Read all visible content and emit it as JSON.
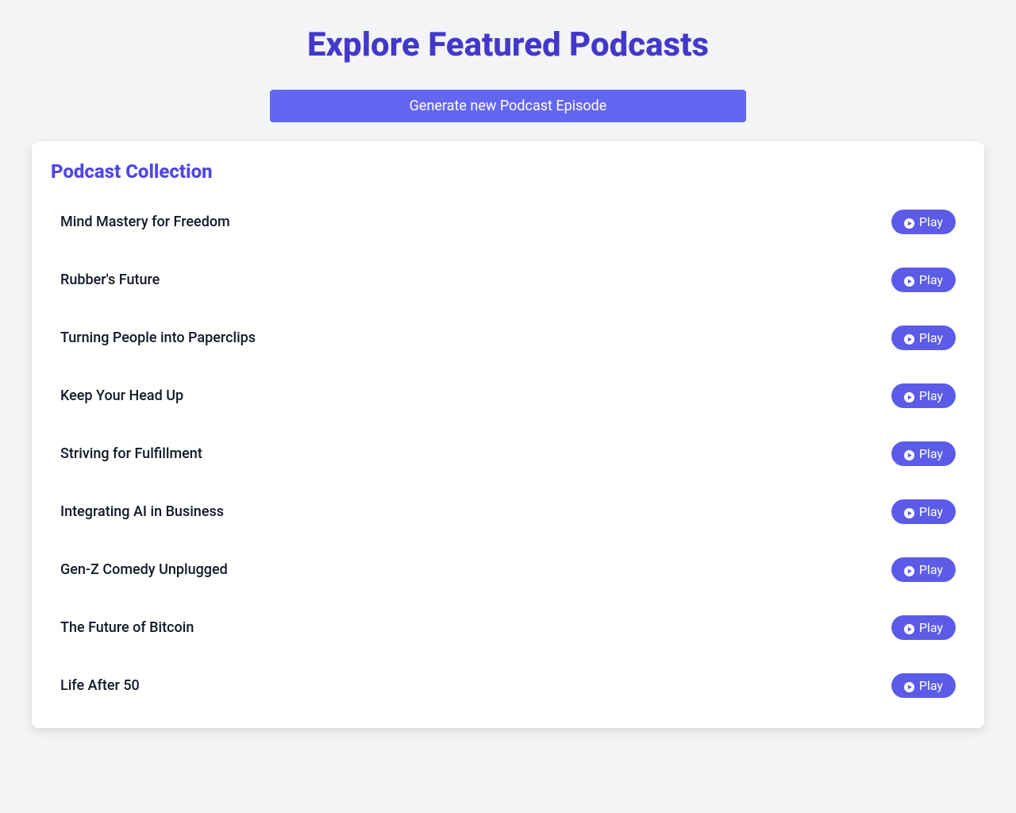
{
  "header": {
    "title": "Explore Featured Podcasts",
    "generate_button_label": "Generate new Podcast Episode"
  },
  "collection": {
    "heading": "Podcast Collection",
    "play_label": "Play",
    "items": [
      {
        "title": "Mind Mastery for Freedom"
      },
      {
        "title": "Rubber's Future"
      },
      {
        "title": "Turning People into Paperclips"
      },
      {
        "title": "Keep Your Head Up"
      },
      {
        "title": "Striving for Fulfillment"
      },
      {
        "title": "Integrating AI in Business"
      },
      {
        "title": "Gen-Z Comedy Unplugged"
      },
      {
        "title": "The Future of Bitcoin"
      },
      {
        "title": "Life After 50"
      }
    ]
  }
}
